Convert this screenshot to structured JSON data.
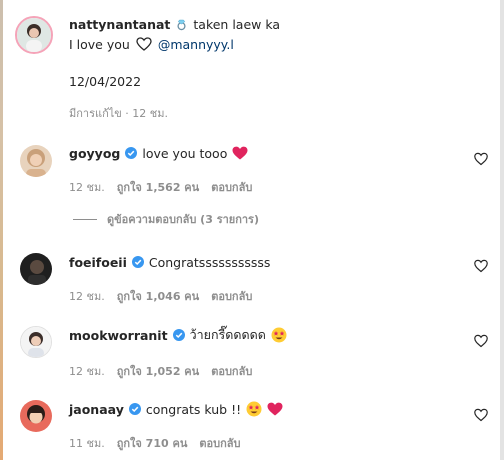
{
  "post": {
    "username": "nattynantanat",
    "caption_text": "taken laew ka",
    "caption_line2": "I love you",
    "mention": "@mannyyy.l",
    "date": "12/04/2022",
    "edited_text": "มีการแก้ไข · 12 ชม."
  },
  "comments": [
    {
      "username": "goyyog",
      "text": "love you tooo",
      "time": "12 ชม.",
      "likes": "ถูกใจ 1,562 คน",
      "reply": "ตอบกลับ",
      "view_replies": "ดูข้อความตอบกลับ (3 รายการ)"
    },
    {
      "username": "foeifoeii",
      "text": "Congratsssssssssss",
      "time": "12 ชม.",
      "likes": "ถูกใจ 1,046 คน",
      "reply": "ตอบกลับ"
    },
    {
      "username": "mookworranit",
      "text": "ว้ายกรี๊ดดดดด",
      "time": "12 ชม.",
      "likes": "ถูกใจ 1,052 คน",
      "reply": "ตอบกลับ"
    },
    {
      "username": "jaonaay",
      "text": "congrats kub !!",
      "time": "11 ชม.",
      "likes": "ถูกใจ 710 คน",
      "reply": "ตอบกลับ"
    }
  ],
  "colors": {
    "verified": "#3897f0",
    "secondary_text": "#8e8e8e",
    "mention": "#00376b",
    "red_heart": "#e0245e"
  },
  "icons": {
    "ring": "ring-emoji-icon",
    "outline_heart": "outline-heart-icon",
    "like": "like-heart-icon",
    "verified": "verified-badge-icon",
    "red_heart": "red-heart-emoji-icon",
    "star_eyes": "star-struck-emoji-icon"
  }
}
